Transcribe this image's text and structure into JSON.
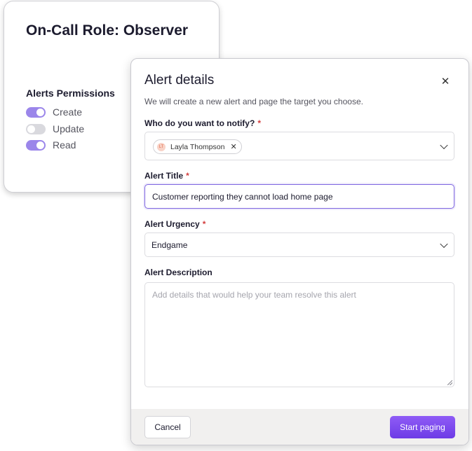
{
  "role_card": {
    "title": "On-Call Role: Observer",
    "permissions_heading": "Alerts Permissions",
    "permissions": [
      {
        "label": "Create",
        "enabled": true
      },
      {
        "label": "Update",
        "enabled": false
      },
      {
        "label": "Read",
        "enabled": true
      }
    ]
  },
  "modal": {
    "title": "Alert details",
    "close_icon": "close-icon",
    "subtitle": "We will create a new alert and page the target you choose.",
    "notify": {
      "label": "Who do you want to notify?",
      "required_mark": "*",
      "chip": {
        "initials": "LT",
        "name": "Layla Thompson"
      }
    },
    "alert_title": {
      "label": "Alert Title",
      "required_mark": "*",
      "value": "Customer reporting they cannot load home page"
    },
    "urgency": {
      "label": "Alert Urgency",
      "required_mark": "*",
      "value": "Endgame"
    },
    "description": {
      "label": "Alert Description",
      "placeholder": "Add details that would help your team resolve this alert"
    },
    "footer": {
      "cancel_label": "Cancel",
      "start_label": "Start paging"
    }
  },
  "colors": {
    "accent": "#7e66e0",
    "toggle_on": "#9b86ea",
    "required": "#d33d3d",
    "primary_button": "#7a48ec"
  }
}
